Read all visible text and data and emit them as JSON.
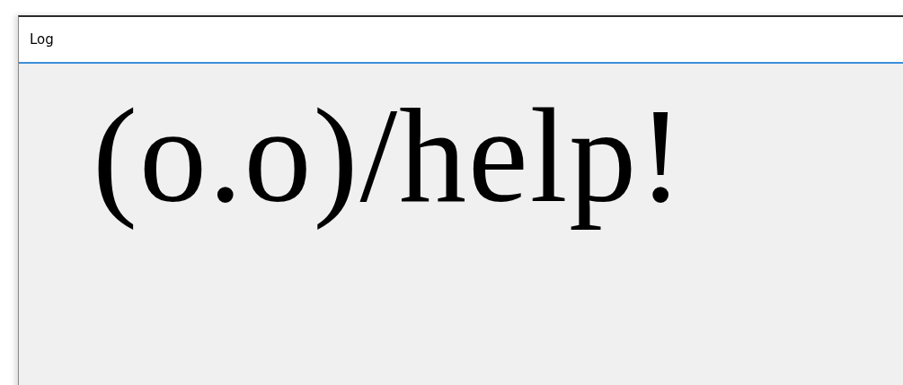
{
  "window": {
    "title": "Log"
  },
  "log": {
    "text": "(o.o)/help!"
  }
}
